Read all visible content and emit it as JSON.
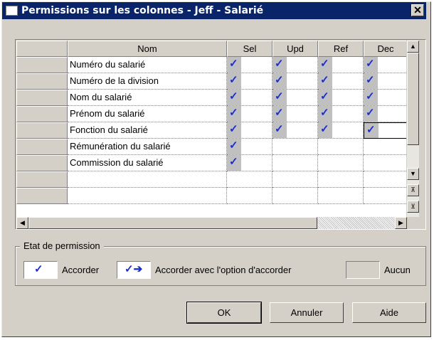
{
  "window": {
    "title": "Permissions sur les colonnes - Jeff - Salarié",
    "close_glyph": "✕"
  },
  "grid": {
    "columns": [
      "Nom",
      "Sel",
      "Upd",
      "Ref",
      "Dec"
    ],
    "rows": [
      {
        "name": "Numéro du salarié",
        "sel": true,
        "upd": true,
        "ref": true,
        "dec": true
      },
      {
        "name": "Numéro de la division",
        "sel": true,
        "upd": true,
        "ref": true,
        "dec": true
      },
      {
        "name": "Nom du salarié",
        "sel": true,
        "upd": true,
        "ref": true,
        "dec": true
      },
      {
        "name": "Prénom du salarié",
        "sel": true,
        "upd": true,
        "ref": true,
        "dec": true
      },
      {
        "name": "Fonction du salarié",
        "sel": true,
        "upd": true,
        "ref": true,
        "dec": true
      },
      {
        "name": "Rémunération du salarié",
        "sel": true,
        "upd": false,
        "ref": false,
        "dec": false
      },
      {
        "name": "Commission du salarié",
        "sel": true,
        "upd": false,
        "ref": false,
        "dec": false
      },
      {
        "name": "",
        "sel": false,
        "upd": false,
        "ref": false,
        "dec": false
      },
      {
        "name": "",
        "sel": false,
        "upd": false,
        "ref": false,
        "dec": false
      }
    ]
  },
  "permission_state": {
    "label": "Etat de permission",
    "grant_label": "Accorder",
    "grant_with_option_label": "Accorder avec l'option d'accorder",
    "none_label": "Aucun",
    "grant_glyph": "✓",
    "grant_with_option_glyph": "✓➔"
  },
  "buttons": {
    "ok": "OK",
    "cancel": "Annuler",
    "help": "Aide"
  },
  "colors": {
    "title_bar": "#0a246a",
    "dialog_bg": "#d4d0c8",
    "check": "#1a2ed0",
    "check_bg": "#c0c0c0"
  }
}
